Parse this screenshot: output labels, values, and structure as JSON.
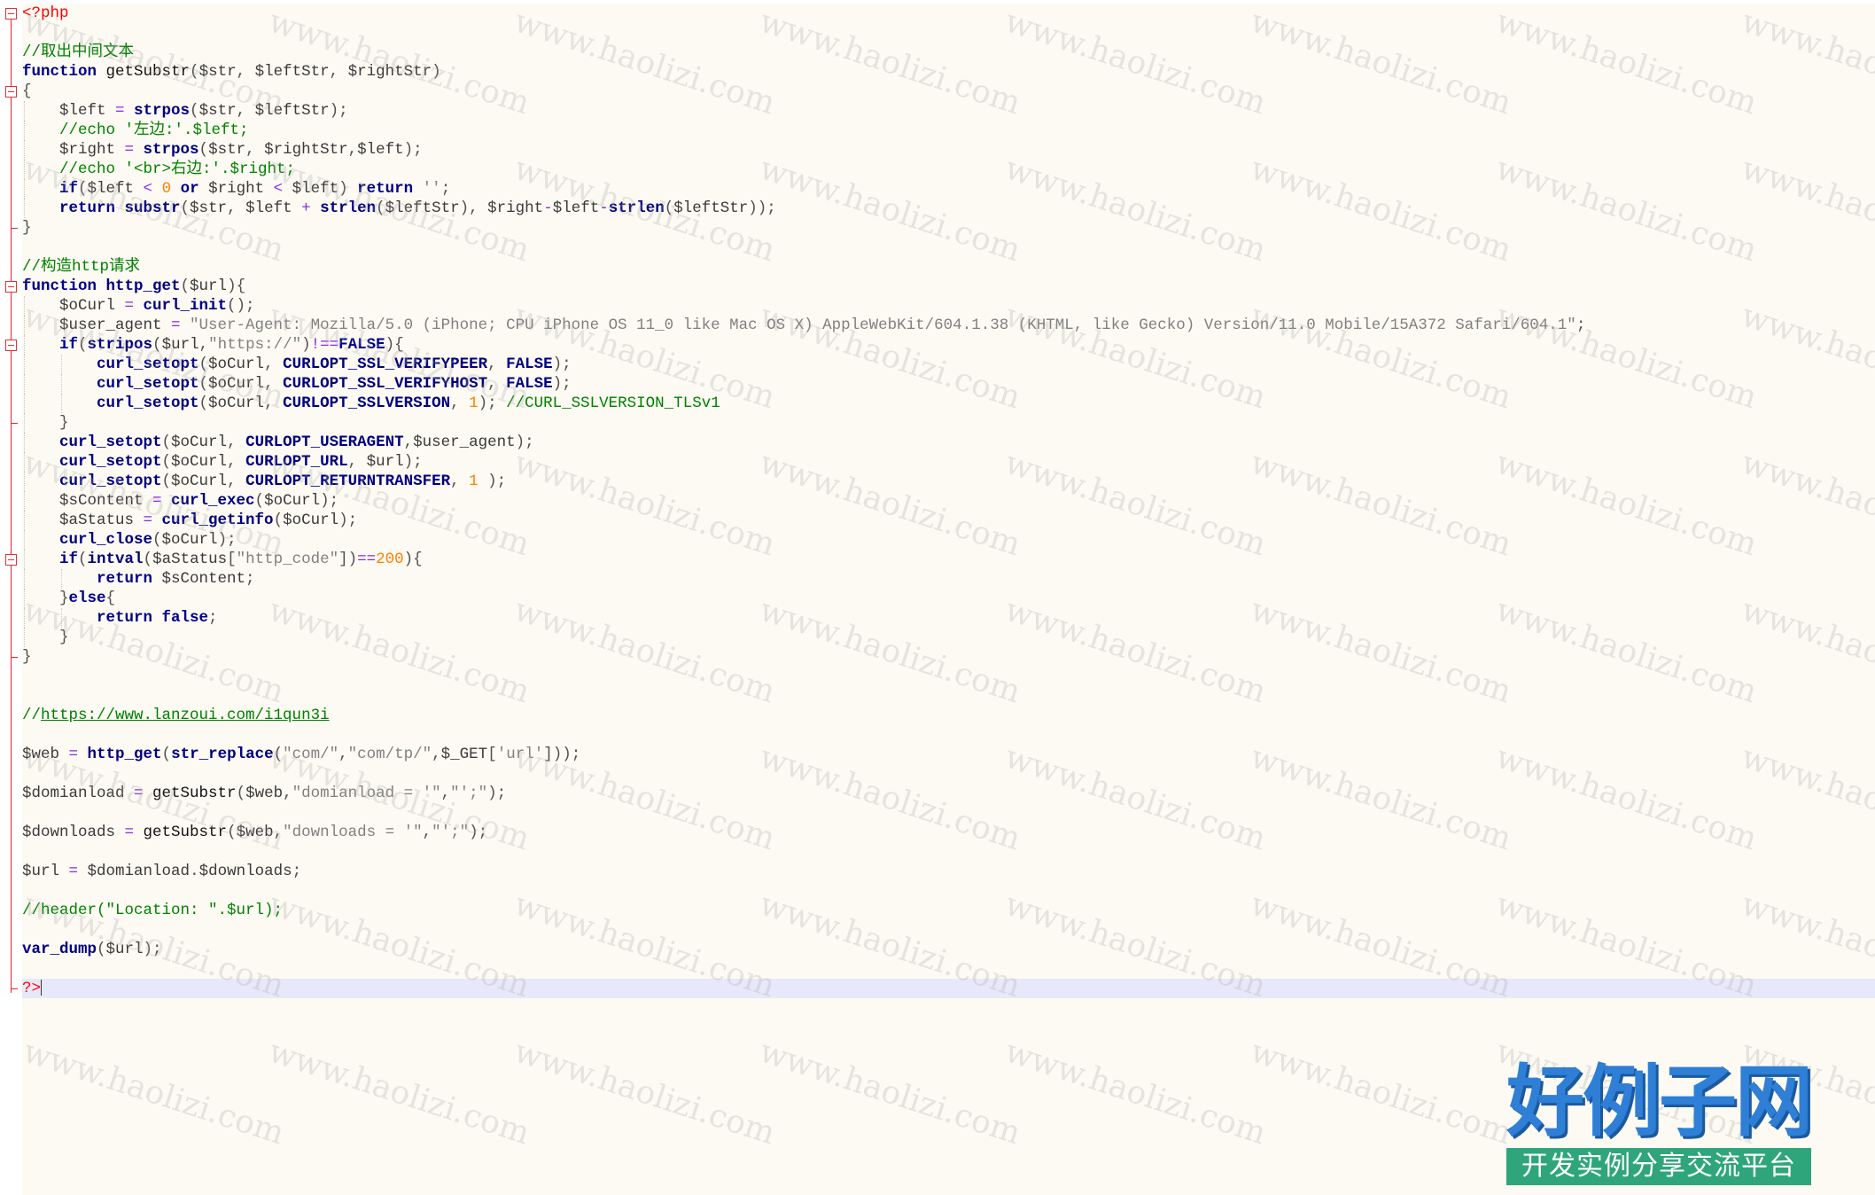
{
  "editor": {
    "lines": [
      {
        "indent": 0,
        "tokens": [
          [
            "tag",
            "<?php"
          ]
        ]
      },
      {
        "indent": 0,
        "tokens": []
      },
      {
        "indent": 0,
        "tokens": [
          [
            "comment",
            "//取出中间文本"
          ]
        ]
      },
      {
        "indent": 0,
        "tokens": [
          [
            "keyword",
            "function"
          ],
          [
            "plain",
            " getSubstr"
          ],
          [
            "default",
            "("
          ],
          [
            "var",
            "$str"
          ],
          [
            "default",
            ", "
          ],
          [
            "var",
            "$leftStr"
          ],
          [
            "default",
            ", "
          ],
          [
            "var",
            "$rightStr"
          ],
          [
            "default",
            ")"
          ]
        ]
      },
      {
        "indent": 0,
        "tokens": [
          [
            "default",
            "{"
          ]
        ]
      },
      {
        "indent": 1,
        "tokens": [
          [
            "var",
            "$left"
          ],
          [
            "op",
            " = "
          ],
          [
            "func",
            "strpos"
          ],
          [
            "default",
            "("
          ],
          [
            "var",
            "$str"
          ],
          [
            "default",
            ", "
          ],
          [
            "var",
            "$leftStr"
          ],
          [
            "default",
            ");"
          ]
        ]
      },
      {
        "indent": 1,
        "tokens": [
          [
            "comment",
            "//echo '左边:'.$left;"
          ]
        ]
      },
      {
        "indent": 1,
        "tokens": [
          [
            "var",
            "$right"
          ],
          [
            "op",
            " = "
          ],
          [
            "func",
            "strpos"
          ],
          [
            "default",
            "("
          ],
          [
            "var",
            "$str"
          ],
          [
            "default",
            ", "
          ],
          [
            "var",
            "$rightStr"
          ],
          [
            "default",
            ","
          ],
          [
            "var",
            "$left"
          ],
          [
            "default",
            ");"
          ]
        ]
      },
      {
        "indent": 1,
        "tokens": [
          [
            "comment",
            "//echo '<br>右边:'.$right;"
          ]
        ]
      },
      {
        "indent": 1,
        "tokens": [
          [
            "keyword",
            "if"
          ],
          [
            "default",
            "("
          ],
          [
            "var",
            "$left"
          ],
          [
            "op",
            " < "
          ],
          [
            "number",
            "0"
          ],
          [
            "keyword",
            " or "
          ],
          [
            "var",
            "$right"
          ],
          [
            "op",
            " < "
          ],
          [
            "var",
            "$left"
          ],
          [
            "default",
            ") "
          ],
          [
            "keyword",
            "return"
          ],
          [
            "string",
            " ''"
          ],
          [
            "default",
            ";"
          ]
        ]
      },
      {
        "indent": 1,
        "tokens": [
          [
            "keyword",
            "return"
          ],
          [
            "func",
            " substr"
          ],
          [
            "default",
            "("
          ],
          [
            "var",
            "$str"
          ],
          [
            "default",
            ", "
          ],
          [
            "var",
            "$left"
          ],
          [
            "op",
            " + "
          ],
          [
            "func",
            "strlen"
          ],
          [
            "default",
            "("
          ],
          [
            "var",
            "$leftStr"
          ],
          [
            "default",
            "), "
          ],
          [
            "var",
            "$right"
          ],
          [
            "op",
            "-"
          ],
          [
            "var",
            "$left"
          ],
          [
            "op",
            "-"
          ],
          [
            "func",
            "strlen"
          ],
          [
            "default",
            "("
          ],
          [
            "var",
            "$leftStr"
          ],
          [
            "default",
            "));"
          ]
        ]
      },
      {
        "indent": 0,
        "tokens": [
          [
            "default",
            "}"
          ]
        ]
      },
      {
        "indent": 0,
        "tokens": []
      },
      {
        "indent": 0,
        "tokens": [
          [
            "comment",
            "//构造http请求"
          ]
        ]
      },
      {
        "indent": 0,
        "tokens": [
          [
            "keyword",
            "function"
          ],
          [
            "func",
            " http_get"
          ],
          [
            "default",
            "("
          ],
          [
            "var",
            "$url"
          ],
          [
            "default",
            "){"
          ]
        ]
      },
      {
        "indent": 1,
        "tokens": [
          [
            "var",
            "$oCurl"
          ],
          [
            "op",
            " = "
          ],
          [
            "func",
            "curl_init"
          ],
          [
            "default",
            "();"
          ]
        ]
      },
      {
        "indent": 1,
        "tokens": [
          [
            "var",
            "$user_agent"
          ],
          [
            "op",
            " = "
          ],
          [
            "string",
            "\"User-Agent: Mozilla/5.0 (iPhone; CPU iPhone OS 11_0 like Mac OS X) AppleWebKit/604.1.38 (KHTML, like Gecko) Version/11.0 Mobile/15A372 Safari/604.1\""
          ],
          [
            "default",
            ";"
          ]
        ]
      },
      {
        "indent": 1,
        "tokens": [
          [
            "keyword",
            "if"
          ],
          [
            "default",
            "("
          ],
          [
            "func",
            "stripos"
          ],
          [
            "default",
            "("
          ],
          [
            "var",
            "$url"
          ],
          [
            "default",
            ","
          ],
          [
            "string",
            "\"https://\""
          ],
          [
            "default",
            ")"
          ],
          [
            "op",
            "!=="
          ],
          [
            "keyword",
            "FALSE"
          ],
          [
            "default",
            "){"
          ]
        ]
      },
      {
        "indent": 2,
        "tokens": [
          [
            "func",
            "curl_setopt"
          ],
          [
            "default",
            "("
          ],
          [
            "var",
            "$oCurl"
          ],
          [
            "default",
            ", "
          ],
          [
            "func",
            "CURLOPT_SSL_VERIFYPEER"
          ],
          [
            "default",
            ", "
          ],
          [
            "keyword",
            "FALSE"
          ],
          [
            "default",
            ");"
          ]
        ]
      },
      {
        "indent": 2,
        "tokens": [
          [
            "func",
            "curl_setopt"
          ],
          [
            "default",
            "("
          ],
          [
            "var",
            "$oCurl"
          ],
          [
            "default",
            ", "
          ],
          [
            "func",
            "CURLOPT_SSL_VERIFYHOST"
          ],
          [
            "default",
            ", "
          ],
          [
            "keyword",
            "FALSE"
          ],
          [
            "default",
            ");"
          ]
        ]
      },
      {
        "indent": 2,
        "tokens": [
          [
            "func",
            "curl_setopt"
          ],
          [
            "default",
            "("
          ],
          [
            "var",
            "$oCurl"
          ],
          [
            "default",
            ", "
          ],
          [
            "func",
            "CURLOPT_SSLVERSION"
          ],
          [
            "default",
            ", "
          ],
          [
            "number",
            "1"
          ],
          [
            "default",
            "); "
          ],
          [
            "comment",
            "//CURL_SSLVERSION_TLSv1"
          ]
        ]
      },
      {
        "indent": 1,
        "tokens": [
          [
            "default",
            "}"
          ]
        ]
      },
      {
        "indent": 1,
        "tokens": [
          [
            "func",
            "curl_setopt"
          ],
          [
            "default",
            "("
          ],
          [
            "var",
            "$oCurl"
          ],
          [
            "default",
            ", "
          ],
          [
            "func",
            "CURLOPT_USERAGENT"
          ],
          [
            "default",
            ","
          ],
          [
            "var",
            "$user_agent"
          ],
          [
            "default",
            ");"
          ]
        ]
      },
      {
        "indent": 1,
        "tokens": [
          [
            "func",
            "curl_setopt"
          ],
          [
            "default",
            "("
          ],
          [
            "var",
            "$oCurl"
          ],
          [
            "default",
            ", "
          ],
          [
            "func",
            "CURLOPT_URL"
          ],
          [
            "default",
            ", "
          ],
          [
            "var",
            "$url"
          ],
          [
            "default",
            ");"
          ]
        ]
      },
      {
        "indent": 1,
        "tokens": [
          [
            "func",
            "curl_setopt"
          ],
          [
            "default",
            "("
          ],
          [
            "var",
            "$oCurl"
          ],
          [
            "default",
            ", "
          ],
          [
            "func",
            "CURLOPT_RETURNTRANSFER"
          ],
          [
            "default",
            ", "
          ],
          [
            "number",
            "1"
          ],
          [
            "default",
            " );"
          ]
        ]
      },
      {
        "indent": 1,
        "tokens": [
          [
            "var",
            "$sContent"
          ],
          [
            "op",
            " = "
          ],
          [
            "func",
            "curl_exec"
          ],
          [
            "default",
            "("
          ],
          [
            "var",
            "$oCurl"
          ],
          [
            "default",
            ");"
          ]
        ]
      },
      {
        "indent": 1,
        "tokens": [
          [
            "var",
            "$aStatus"
          ],
          [
            "op",
            " = "
          ],
          [
            "func",
            "curl_getinfo"
          ],
          [
            "default",
            "("
          ],
          [
            "var",
            "$oCurl"
          ],
          [
            "default",
            ");"
          ]
        ]
      },
      {
        "indent": 1,
        "tokens": [
          [
            "func",
            "curl_close"
          ],
          [
            "default",
            "("
          ],
          [
            "var",
            "$oCurl"
          ],
          [
            "default",
            ");"
          ]
        ]
      },
      {
        "indent": 1,
        "tokens": [
          [
            "keyword",
            "if"
          ],
          [
            "default",
            "("
          ],
          [
            "func",
            "intval"
          ],
          [
            "default",
            "("
          ],
          [
            "var",
            "$aStatus"
          ],
          [
            "default",
            "["
          ],
          [
            "string",
            "\"http_code\""
          ],
          [
            "default",
            "])"
          ],
          [
            "op",
            "=="
          ],
          [
            "number",
            "200"
          ],
          [
            "default",
            "){"
          ]
        ]
      },
      {
        "indent": 2,
        "tokens": [
          [
            "keyword",
            "return"
          ],
          [
            "var",
            " $sContent"
          ],
          [
            "default",
            ";"
          ]
        ]
      },
      {
        "indent": 1,
        "tokens": [
          [
            "default",
            "}"
          ],
          [
            "keyword",
            "else"
          ],
          [
            "default",
            "{"
          ]
        ]
      },
      {
        "indent": 2,
        "tokens": [
          [
            "keyword",
            "return"
          ],
          [
            "keyword",
            " false"
          ],
          [
            "default",
            ";"
          ]
        ]
      },
      {
        "indent": 1,
        "tokens": [
          [
            "default",
            "}"
          ]
        ]
      },
      {
        "indent": 0,
        "tokens": [
          [
            "default",
            "}"
          ]
        ]
      },
      {
        "indent": 0,
        "tokens": []
      },
      {
        "indent": 0,
        "tokens": []
      },
      {
        "indent": 0,
        "tokens": [
          [
            "comment",
            "//"
          ],
          [
            "link",
            "https://www.lanzoui.com/i1qun3i"
          ]
        ]
      },
      {
        "indent": 0,
        "tokens": []
      },
      {
        "indent": 0,
        "tokens": [
          [
            "var",
            "$web"
          ],
          [
            "op",
            " = "
          ],
          [
            "func",
            "http_get"
          ],
          [
            "default",
            "("
          ],
          [
            "func",
            "str_replace"
          ],
          [
            "default",
            "("
          ],
          [
            "string",
            "\"com/\""
          ],
          [
            "default",
            ","
          ],
          [
            "string",
            "\"com/tp/\""
          ],
          [
            "default",
            ","
          ],
          [
            "var",
            "$_GET"
          ],
          [
            "default",
            "["
          ],
          [
            "string",
            "'url'"
          ],
          [
            "default",
            "]));"
          ]
        ]
      },
      {
        "indent": 0,
        "tokens": []
      },
      {
        "indent": 0,
        "tokens": [
          [
            "var",
            "$domianload"
          ],
          [
            "op",
            " = "
          ],
          [
            "plain",
            "getSubstr"
          ],
          [
            "default",
            "("
          ],
          [
            "var",
            "$web"
          ],
          [
            "default",
            ","
          ],
          [
            "string",
            "\"domianload = '\""
          ],
          [
            "default",
            ","
          ],
          [
            "string",
            "\"';\""
          ],
          [
            "default",
            ");"
          ]
        ]
      },
      {
        "indent": 0,
        "tokens": []
      },
      {
        "indent": 0,
        "tokens": [
          [
            "var",
            "$downloads"
          ],
          [
            "op",
            " = "
          ],
          [
            "plain",
            "getSubstr"
          ],
          [
            "default",
            "("
          ],
          [
            "var",
            "$web"
          ],
          [
            "default",
            ","
          ],
          [
            "string",
            "\"downloads = '\""
          ],
          [
            "default",
            ","
          ],
          [
            "string",
            "\"';\""
          ],
          [
            "default",
            ");"
          ]
        ]
      },
      {
        "indent": 0,
        "tokens": []
      },
      {
        "indent": 0,
        "tokens": [
          [
            "var",
            "$url"
          ],
          [
            "op",
            " = "
          ],
          [
            "var",
            "$domianload"
          ],
          [
            "default",
            "."
          ],
          [
            "var",
            "$downloads"
          ],
          [
            "default",
            ";"
          ]
        ]
      },
      {
        "indent": 0,
        "tokens": []
      },
      {
        "indent": 0,
        "tokens": [
          [
            "comment",
            "//header(\"Location: \".$url);"
          ]
        ]
      },
      {
        "indent": 0,
        "tokens": []
      },
      {
        "indent": 0,
        "tokens": [
          [
            "func",
            "var_dump"
          ],
          [
            "default",
            "("
          ],
          [
            "var",
            "$url"
          ],
          [
            "default",
            ");"
          ]
        ]
      },
      {
        "indent": 0,
        "tokens": []
      },
      {
        "indent": 0,
        "tokens": [
          [
            "tag",
            "?>"
          ]
        ],
        "current": true
      }
    ],
    "fold_markers": [
      0,
      4,
      14,
      17,
      28
    ],
    "fold_ends": [
      11,
      21,
      33,
      50
    ]
  },
  "watermark_text": "www.haolizi.com",
  "logo": {
    "title": "好例子网",
    "subtitle": "开发实例分享交流平台"
  }
}
